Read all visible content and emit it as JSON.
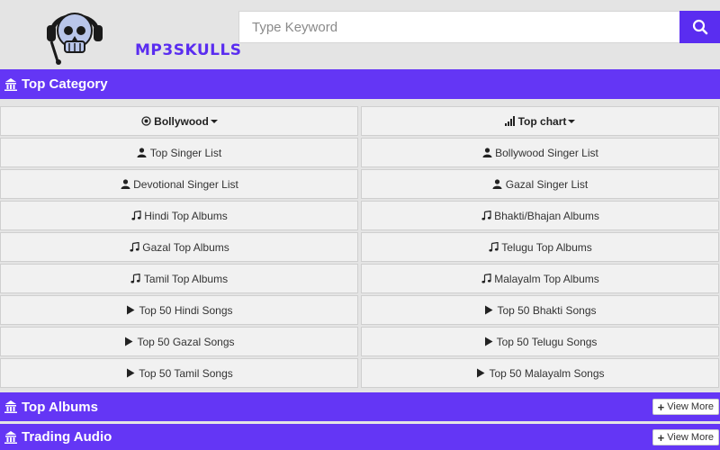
{
  "header": {
    "logo_text": "MP3SKULLS",
    "search_placeholder": "Type Keyword"
  },
  "sections": {
    "top_category": "Top Category",
    "top_albums": "Top Albums",
    "trading_audio": "Trading Audio",
    "view_more": "View More"
  },
  "category_heads": [
    "Bollywood",
    "Top chart"
  ],
  "category_rows": [
    [
      {
        "icon": "user-icon",
        "label": "Top Singer List"
      },
      {
        "icon": "user-icon",
        "label": "Bollywood Singer List"
      }
    ],
    [
      {
        "icon": "user-icon",
        "label": "Devotional Singer List"
      },
      {
        "icon": "user-icon",
        "label": "Gazal Singer List"
      }
    ],
    [
      {
        "icon": "music-note-icon",
        "label": "Hindi Top Albums"
      },
      {
        "icon": "music-note-icon",
        "label": "Bhakti/Bhajan Albums"
      }
    ],
    [
      {
        "icon": "music-note-icon",
        "label": "Gazal Top Albums"
      },
      {
        "icon": "music-note-icon",
        "label": "Telugu Top Albums"
      }
    ],
    [
      {
        "icon": "music-note-icon",
        "label": "Tamil Top Albums"
      },
      {
        "icon": "music-note-icon",
        "label": "Malayalm Top Albums"
      }
    ],
    [
      {
        "icon": "play-icon",
        "label": "Top 50 Hindi Songs"
      },
      {
        "icon": "play-icon",
        "label": "Top 50 Bhakti Songs"
      }
    ],
    [
      {
        "icon": "play-icon",
        "label": "Top 50 Gazal Songs"
      },
      {
        "icon": "play-icon",
        "label": "Top 50 Telugu Songs"
      }
    ],
    [
      {
        "icon": "play-icon",
        "label": "Top 50 Tamil Songs"
      },
      {
        "icon": "play-icon",
        "label": "Top 50 Malayalm Songs"
      }
    ]
  ],
  "colors": {
    "accent": "#6436f5",
    "search_button": "#5a2df0",
    "background": "#e4e4e4"
  }
}
